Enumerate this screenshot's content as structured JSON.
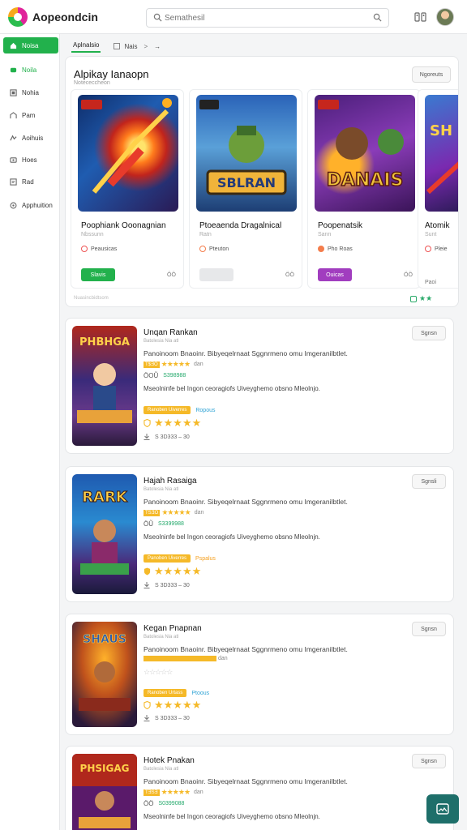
{
  "app": {
    "title": "Aopeondcin"
  },
  "search": {
    "placeholder": "Semathesil"
  },
  "sidebar": {
    "items": [
      {
        "label": "Noisa",
        "icon": "home-icon"
      },
      {
        "label": "Noila",
        "icon": "games-icon"
      },
      {
        "label": "Nohia",
        "icon": "apps-icon"
      },
      {
        "label": "Pam",
        "icon": "movies-icon"
      },
      {
        "label": "Aoihuis",
        "icon": "books-icon"
      },
      {
        "label": "Hoes",
        "icon": "kids-icon"
      },
      {
        "label": "Rad",
        "icon": "library-icon"
      },
      {
        "label": "Apphuition",
        "icon": "settings-icon"
      }
    ]
  },
  "breadcrumb": {
    "tab": "Aplnalsio",
    "item": "Nais",
    "sep1": ">",
    "sep2": "→"
  },
  "featured": {
    "title": "Alpikay Ianaopn",
    "subtitle": "Notececcheon",
    "button": "Ngoreuts",
    "footer": "Nuasincbidtsom",
    "nav": "★★",
    "cards": [
      {
        "title": "Poophiank Ooonagnian",
        "sub": "Nbssunn",
        "tag": "Peausicas",
        "button": "Slavis",
        "meta": "ÔÖ",
        "button_color": "#22b14c"
      },
      {
        "title": "Ptoeaenda Dragalnical",
        "sub": "Ratn",
        "tag": "Pteuton",
        "button": "",
        "meta": "ÖÖ",
        "button_color": "#e7e8ea"
      },
      {
        "title": "Poopenatsik",
        "sub": "Sann",
        "tag": "Pho Roas",
        "button": "Ouicas",
        "meta": "ÖÖ",
        "button_color": "#a13dbf"
      },
      {
        "title": "Atomik",
        "sub": "Sunt",
        "tag": "Pleie",
        "button": "Paoi",
        "meta": "",
        "button_color": "#ffffff"
      }
    ]
  },
  "list": [
    {
      "title": "Unqan Rankan",
      "sub": "Batolesia Nia atl",
      "desc1": "Panoinoom Bnaoinr. Bibyeqelrnaat Sggnrmeno omu Imgeranilbtlet.",
      "rate_badge": "T$ƎÖ",
      "rating_text": "dan",
      "stats": "ÖOŨ",
      "stats_green": "S398988",
      "desc2": "Mseolninfe bel Ingon ceoragiofs Uiveyghemo obsno Mleolnjo.",
      "badge": "Ranoben Uiverres",
      "badge_blue": "Ropous",
      "footer": "S 3D333 – 30",
      "button": "Sgnsn"
    },
    {
      "title": "Hajah Rasaiga",
      "sub": "Batolesia Nia atl",
      "desc1": "Panoinoom Bnaoinr. Sibyeqelrnaat Sggnrmeno omu Imgeranilbtlet.",
      "rate_badge": "TSƎÖ",
      "rating_text": "dan",
      "stats": "ÖŨ",
      "stats_green": "S3399988",
      "desc2": "Mseolninfe bel Ingon ceoragiofs Uiveyghemo obsno Mleolnjn.",
      "badge": "Panoben Uiverres",
      "badge_blue": "Pspalus",
      "footer": "S 3D333 – 30",
      "button": "Sgnsli"
    },
    {
      "title": "Kegan Pnapnan",
      "sub": "Batolesia Nia atl",
      "desc1": "Panoinoom Bnaoinr. Bibyeqelrnaat Sggnrmeno omu Imgeranilbtlet.",
      "rate_badge": "",
      "rating_text": "dan",
      "stats": "",
      "stats_green": "",
      "desc2": "",
      "badge": "Ranoben Urtass",
      "badge_blue": "Ptoous",
      "footer": "S 3D333 – 30",
      "button": "Sgnsn"
    },
    {
      "title": "Hotek Pnakan",
      "sub": "Batolesia Nia atl",
      "desc1": "Panoinoom Bnaoinr. Sibyeqelrnaat Sggnrmeno omu Imgeranilbtlet.",
      "rate_badge": "TƎSƎ",
      "rating_text": "dan",
      "stats": "ÖÖ",
      "stats_green": "S0399088",
      "desc2": "Mseolninfe bel Ingon ceoragiofs Uiveyghemo obsno Mleolnjn.",
      "badge": "",
      "badge_blue": "",
      "footer": "",
      "button": "Sgnsn"
    }
  ],
  "colors": {
    "accent": "#22b14c",
    "star": "#f5b928",
    "fab": "#1e6f6a"
  }
}
